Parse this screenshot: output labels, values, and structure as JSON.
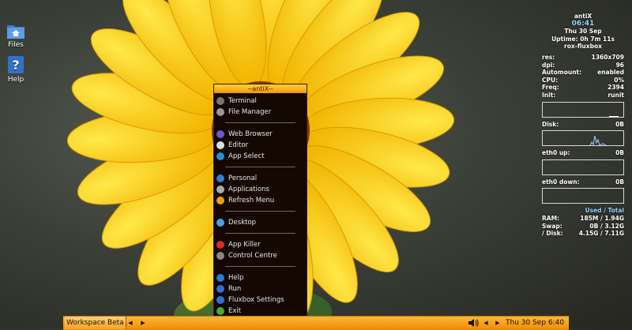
{
  "desktop": {
    "icons": [
      {
        "label": "Files",
        "icon": "home-folder-icon"
      },
      {
        "label": "Help",
        "icon": "help-icon"
      }
    ]
  },
  "menu": {
    "title": "--antiX--",
    "items": [
      {
        "label": "Terminal",
        "icon": "terminal-icon",
        "color": "#777777"
      },
      {
        "label": "File Manager",
        "icon": "file-manager-icon",
        "color": "#999999"
      },
      {
        "label": "Web Browser",
        "icon": "web-browser-icon",
        "color": "#6a5acd"
      },
      {
        "label": "Editor",
        "icon": "editor-icon",
        "color": "#dddddd"
      },
      {
        "label": "App Select",
        "icon": "app-select-icon",
        "color": "#2a8ad4"
      },
      {
        "label": "Personal",
        "icon": "personal-icon",
        "color": "#3a7ad0"
      },
      {
        "label": "Applications",
        "icon": "applications-icon",
        "color": "#aaaaaa"
      },
      {
        "label": "Refresh Menu",
        "icon": "refresh-icon",
        "color": "#e8a000"
      },
      {
        "label": "Desktop",
        "icon": "desktop-icon",
        "color": "#4aa0e0"
      },
      {
        "label": "App Killer",
        "icon": "app-killer-icon",
        "color": "#d03030"
      },
      {
        "label": "Control Centre",
        "icon": "control-centre-icon",
        "color": "#888888"
      },
      {
        "label": "Help",
        "icon": "help-icon",
        "color": "#2a7ad8"
      },
      {
        "label": "Run",
        "icon": "run-icon",
        "color": "#3a6ad0"
      },
      {
        "label": "Fluxbox Settings",
        "icon": "settings-icon",
        "color": "#3a6ad0"
      },
      {
        "label": "Exit",
        "icon": "exit-icon",
        "color": "#4aaa30"
      }
    ]
  },
  "conky": {
    "name": "antiX",
    "time": "06:41",
    "date": "Thu 30 Sep",
    "uptime": "Uptime: 0h 7m 11s",
    "host": "rox-fluxbox",
    "stats": [
      {
        "label": "res:",
        "value": "1360x709"
      },
      {
        "label": "dpi:",
        "value": "96"
      },
      {
        "label": "Automount:",
        "value": "enabled"
      },
      {
        "label": "CPU:",
        "value": "0%"
      },
      {
        "label": "Freq:",
        "value": "2394"
      },
      {
        "label": "Init:",
        "value": "runit"
      }
    ],
    "disk": {
      "label": "Disk:",
      "value": "0B"
    },
    "eth_up": {
      "label": "eth0 up:",
      "value": "0B"
    },
    "eth_down": {
      "label": "eth0 down:",
      "value": "0B"
    },
    "usage_header": "Used / Total",
    "usage": [
      {
        "label": "RAM:",
        "used": "185M",
        "total": "/ 1.94G"
      },
      {
        "label": "Swap:",
        "used": "0B",
        "total": "/ 3.12G"
      },
      {
        "label": "/ Disk:",
        "used": "4.15G",
        "total": "/ 7.11G"
      }
    ]
  },
  "taskbar": {
    "workspace": "Workspace Beta",
    "prev": "◀",
    "next": "▶",
    "volume_icon": "volume-icon",
    "clock": "Thu 30 Sep   6:40"
  }
}
